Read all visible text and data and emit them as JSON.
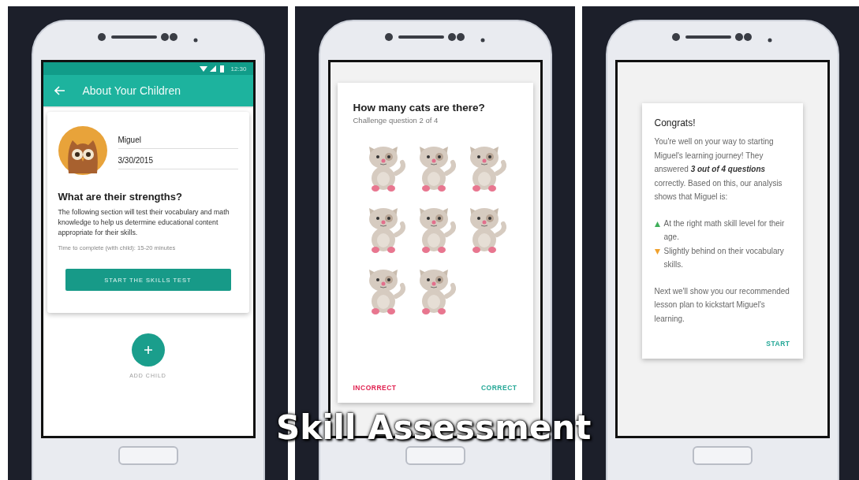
{
  "phones": [
    {
      "kind": "profile",
      "status_time": "12:30",
      "app_title": "About Your Children",
      "child_name": "Miguel",
      "birthdate": "3/30/2015",
      "heading": "What are their strengths?",
      "description": "The following section will test their vocabulary and math knowledge to help us determine educational content appropriate for their skills.",
      "time_note": "Time to complete (with child): 15-20 minutes",
      "button": "START THE SKILLS TEST",
      "fab_label": "ADD CHILD"
    },
    {
      "kind": "quiz",
      "question": "How many cats are there?",
      "subtitle": "Challenge question 2 of 4",
      "images": [
        {
          "kind": "cat"
        },
        {
          "kind": "cat"
        },
        {
          "kind": "cat"
        },
        {
          "kind": "cat"
        },
        {
          "kind": "cat"
        },
        {
          "kind": "cat"
        },
        {
          "kind": "cat"
        },
        {
          "kind": "cat"
        }
      ],
      "actions": [
        {
          "kind": "incorrect",
          "label": "INCORRECT"
        },
        {
          "kind": "correct",
          "label": "CORRECT"
        }
      ]
    },
    {
      "kind": "result",
      "title": "Congrats!",
      "intro": "You're well on your way to starting Miguel's learning journey! They answered **3 out of 4 questions** correctly. Based on this, our analysis shows that Miguel is:",
      "points": [
        {
          "kind": "up",
          "text": "At the right math skill level for their age."
        },
        {
          "kind": "down",
          "text": "Slightly behind on their vocabulary skills."
        }
      ],
      "outro": "Next we'll show you our recommended lesson plan to kickstart Miguel's learning.",
      "action": "START"
    }
  ],
  "caption": "Skill Assessment"
}
